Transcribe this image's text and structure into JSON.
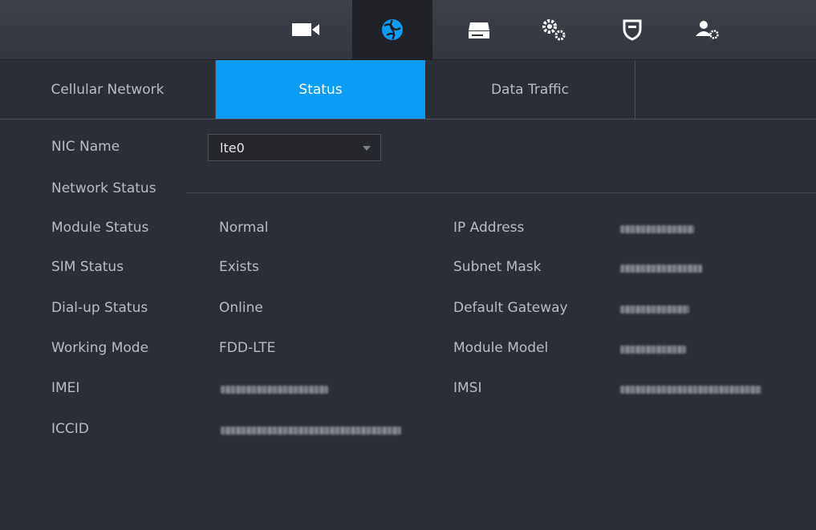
{
  "topbar": {
    "icons": [
      {
        "name": "camera-icon"
      },
      {
        "name": "network-globe-icon"
      },
      {
        "name": "storage-icon"
      },
      {
        "name": "system-gears-icon"
      },
      {
        "name": "security-shield-icon"
      },
      {
        "name": "account-settings-icon"
      }
    ]
  },
  "tabs": [
    {
      "label": "Cellular Network"
    },
    {
      "label": "Status"
    },
    {
      "label": "Data Traffic"
    }
  ],
  "nic": {
    "label": "NIC Name",
    "value": "lte0"
  },
  "section": {
    "network_status": "Network Status"
  },
  "status": {
    "module_status": {
      "label": "Module Status",
      "value": "Normal"
    },
    "sim_status": {
      "label": "SIM Status",
      "value": "Exists"
    },
    "dialup_status": {
      "label": "Dial-up Status",
      "value": "Online"
    },
    "working_mode": {
      "label": "Working Mode",
      "value": "FDD-LTE"
    },
    "imei": {
      "label": "IMEI"
    },
    "iccid": {
      "label": "ICCID"
    },
    "ip_address": {
      "label": "IP Address"
    },
    "subnet_mask": {
      "label": "Subnet Mask"
    },
    "default_gateway": {
      "label": "Default Gateway"
    },
    "module_model": {
      "label": "Module Model"
    },
    "imsi": {
      "label": "IMSI"
    }
  },
  "colors": {
    "accent": "#0b9cf5",
    "background": "#2b2e36"
  }
}
